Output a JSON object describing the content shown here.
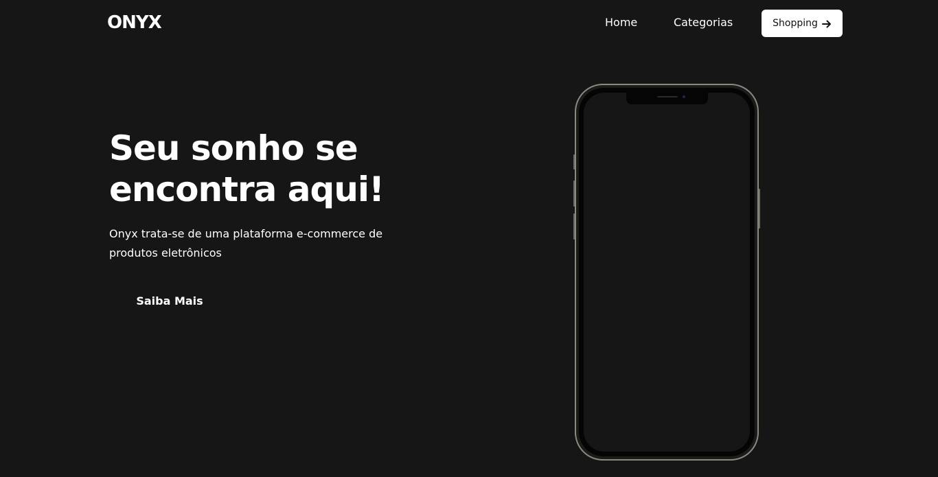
{
  "brand": {
    "logo_text": "ONYX"
  },
  "nav": {
    "links": [
      {
        "label": "Home",
        "icon": null
      },
      {
        "label": "Categorias",
        "icon": null
      }
    ],
    "shopping_button": {
      "label": "Shopping",
      "icon": "arrow-right-icon"
    }
  },
  "hero": {
    "title": "Seu sonho se encontra aqui!",
    "subtitle": "Onyx trata-se de uma plataforma e-commerce de produtos eletrônicos",
    "cta_label": "Saiba Mais",
    "image": "smartphone-mockup"
  },
  "colors": {
    "background": "#161616",
    "text": "#ffffff",
    "button_bg": "#ffffff",
    "button_text": "#111111",
    "phone_frame": "#8c8a80",
    "phone_screen": "#161616"
  }
}
